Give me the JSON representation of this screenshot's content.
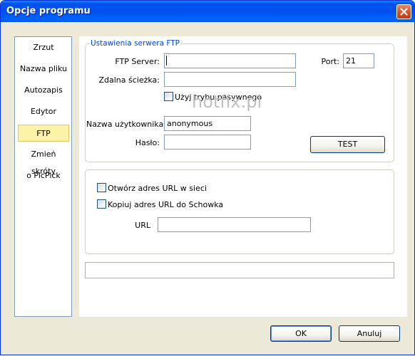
{
  "window": {
    "title": "Opcje programu"
  },
  "sidebar": {
    "items": [
      {
        "label": "Zrzut"
      },
      {
        "label": "Nazwa pliku"
      },
      {
        "label": "Autozapis"
      },
      {
        "label": "Edytor"
      },
      {
        "label": "FTP",
        "selected": true
      },
      {
        "label": "Zmień skróty"
      },
      {
        "label": "o PicPick"
      }
    ]
  },
  "ftp": {
    "legend": "Ustawienia serwera FTP",
    "server_label": "FTP Server:",
    "server_value": "",
    "port_label": "Port:",
    "port_value": "21",
    "path_label": "Zdalna ścieżka:",
    "path_value": "",
    "passive_label": "Użyj trybu pasywnego",
    "passive_checked": false,
    "user_label": "Nazwa użytkownika:",
    "user_value": "anonymous",
    "password_label": "Hasło:",
    "password_value": "",
    "test_label": "TEST"
  },
  "url": {
    "open_label": "Otwórz adres URL w sieci",
    "open_checked": false,
    "copy_label": "Kopiuj adres URL do Schowka",
    "copy_checked": false,
    "url_label": "URL",
    "url_value": ""
  },
  "watermark": "hotfix.pl",
  "footer": {
    "ok_label": "OK",
    "cancel_label": "Anuluj"
  },
  "colors": {
    "title_bar": "#0054e3",
    "legend_text": "#0046d5",
    "selected_item": "#fdf2a8"
  }
}
